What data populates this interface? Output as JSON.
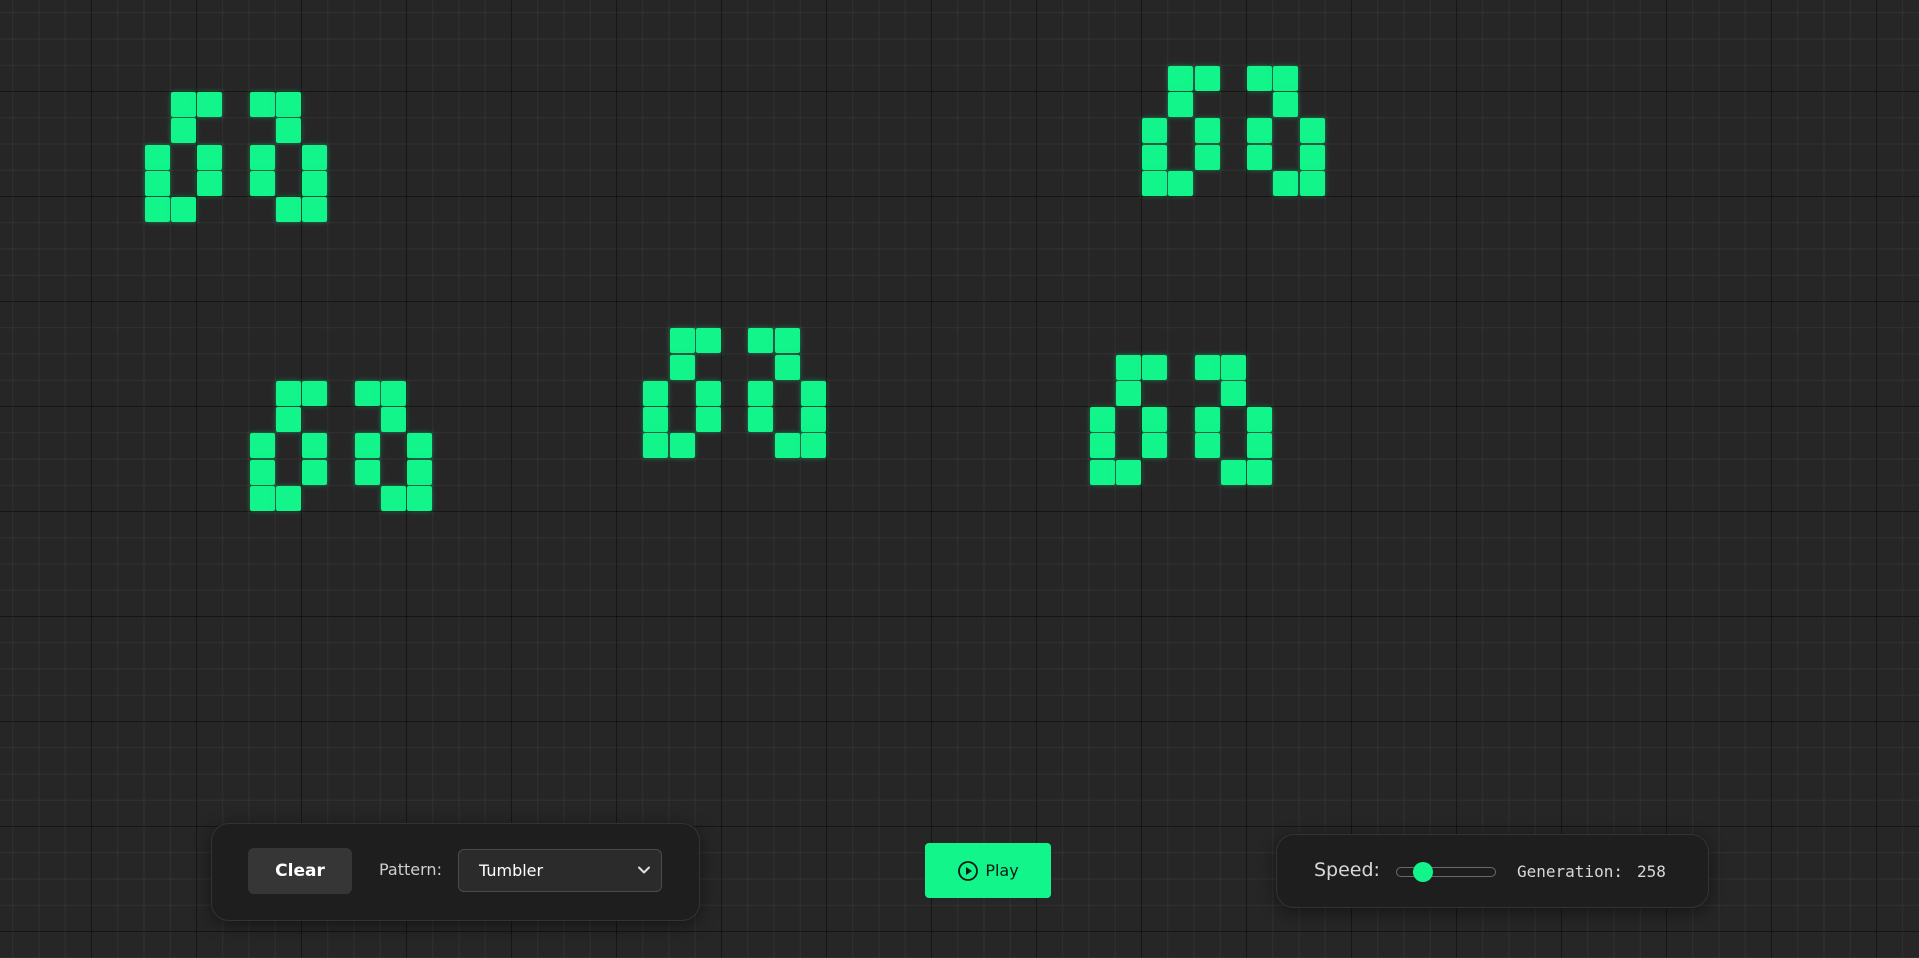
{
  "controls": {
    "clear_label": "Clear",
    "pattern_label": "Pattern:",
    "pattern_value": "Tumbler",
    "play_label": "Play",
    "speed_label": "Speed:",
    "speed_fraction": 0.22,
    "generation_label": "Generation:",
    "generation_value": "258"
  },
  "colors": {
    "live_cell": "#11f58b",
    "background": "#262626",
    "panel": "#1e1e1e"
  },
  "icons": {
    "play": "play-circle-icon",
    "dropdown": "chevron-down-icon"
  },
  "grid": {
    "live_cells": [
      [
        7,
        4
      ],
      [
        8,
        4
      ],
      [
        10,
        4
      ],
      [
        11,
        4
      ],
      [
        7,
        5
      ],
      [
        11,
        5
      ],
      [
        6,
        6
      ],
      [
        8,
        6
      ],
      [
        10,
        6
      ],
      [
        12,
        6
      ],
      [
        6,
        7
      ],
      [
        8,
        7
      ],
      [
        10,
        7
      ],
      [
        12,
        7
      ],
      [
        6,
        8
      ],
      [
        7,
        8
      ],
      [
        11,
        8
      ],
      [
        12,
        8
      ],
      [
        45,
        3
      ],
      [
        46,
        3
      ],
      [
        48,
        3
      ],
      [
        49,
        3
      ],
      [
        45,
        4
      ],
      [
        49,
        4
      ],
      [
        44,
        5
      ],
      [
        46,
        5
      ],
      [
        48,
        5
      ],
      [
        50,
        5
      ],
      [
        44,
        6
      ],
      [
        46,
        6
      ],
      [
        48,
        6
      ],
      [
        50,
        6
      ],
      [
        44,
        7
      ],
      [
        45,
        7
      ],
      [
        49,
        7
      ],
      [
        50,
        7
      ],
      [
        26,
        13
      ],
      [
        27,
        13
      ],
      [
        29,
        13
      ],
      [
        30,
        13
      ],
      [
        26,
        14
      ],
      [
        30,
        14
      ],
      [
        25,
        15
      ],
      [
        27,
        15
      ],
      [
        29,
        15
      ],
      [
        31,
        15
      ],
      [
        25,
        16
      ],
      [
        27,
        16
      ],
      [
        29,
        16
      ],
      [
        31,
        16
      ],
      [
        25,
        17
      ],
      [
        26,
        17
      ],
      [
        30,
        17
      ],
      [
        31,
        17
      ],
      [
        11,
        15
      ],
      [
        12,
        15
      ],
      [
        14,
        15
      ],
      [
        15,
        15
      ],
      [
        11,
        16
      ],
      [
        15,
        16
      ],
      [
        10,
        17
      ],
      [
        12,
        17
      ],
      [
        14,
        17
      ],
      [
        16,
        17
      ],
      [
        10,
        18
      ],
      [
        12,
        18
      ],
      [
        14,
        18
      ],
      [
        16,
        18
      ],
      [
        10,
        19
      ],
      [
        11,
        19
      ],
      [
        15,
        19
      ],
      [
        16,
        19
      ],
      [
        43,
        14
      ],
      [
        44,
        14
      ],
      [
        46,
        14
      ],
      [
        47,
        14
      ],
      [
        43,
        15
      ],
      [
        47,
        15
      ],
      [
        42,
        16
      ],
      [
        44,
        16
      ],
      [
        46,
        16
      ],
      [
        48,
        16
      ],
      [
        42,
        17
      ],
      [
        44,
        17
      ],
      [
        46,
        17
      ],
      [
        48,
        17
      ],
      [
        42,
        18
      ],
      [
        43,
        18
      ],
      [
        47,
        18
      ],
      [
        48,
        18
      ]
    ]
  }
}
